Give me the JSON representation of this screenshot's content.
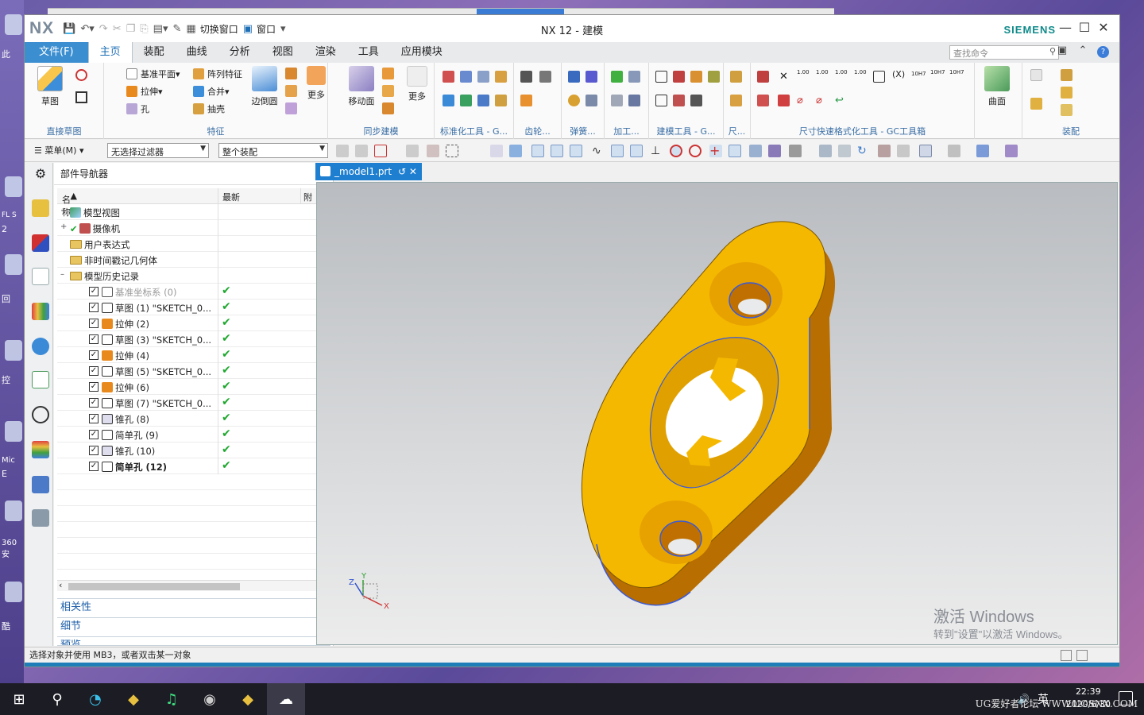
{
  "desktop": {
    "labels": [
      "此",
      "FL S",
      "2",
      "回",
      "控",
      "Mic",
      "E",
      "360安",
      "酷"
    ]
  },
  "window": {
    "logo": "NX",
    "title": "NX 12 - 建模",
    "brand": "SIEMENS",
    "quick_access": {
      "switch_window": "切换窗口",
      "window": "窗口"
    }
  },
  "menu": {
    "file": "文件(F)",
    "tabs": [
      "主页",
      "装配",
      "曲线",
      "分析",
      "视图",
      "渲染",
      "工具",
      "应用模块"
    ],
    "search_placeholder": "查找命令"
  },
  "ribbon": {
    "sketch": "草图",
    "extrude": "拉伸",
    "hole": "孔",
    "datum_plane": "基准平面",
    "pattern_feature": "阵列特征",
    "unite": "合并",
    "shell": "抽壳",
    "edge_blend": "边倒圆",
    "more1": "更多",
    "move_face": "移动面",
    "more2": "更多",
    "surface": "曲面",
    "groups": [
      "直接草图",
      "特征",
      "同步建模",
      "标准化工具 - G...",
      "齿轮...",
      "弹簧...",
      "加工...",
      "建模工具 - G...",
      "尺...",
      "尺寸快速格式化工具 - GC工具箱",
      "装配"
    ]
  },
  "toolbar": {
    "menu": "菜单(M)",
    "filter": "无选择过滤器",
    "scope": "整个装配"
  },
  "navigator": {
    "title": "部件导航器",
    "col_name": "名称",
    "col_latest": "最新",
    "col_extra": "附",
    "top_items": [
      "模型视图",
      "摄像机",
      "用户表达式",
      "非时间戳记几何体",
      "模型历史记录"
    ],
    "history": [
      {
        "label": "基准坐标系 (0)",
        "type": "datum"
      },
      {
        "label": "草图 (1) \"SKETCH_0...",
        "type": "sketch"
      },
      {
        "label": "拉伸 (2)",
        "type": "extrude"
      },
      {
        "label": "草图 (3) \"SKETCH_0...",
        "type": "sketch"
      },
      {
        "label": "拉伸 (4)",
        "type": "extrude"
      },
      {
        "label": "草图 (5) \"SKETCH_0...",
        "type": "sketch"
      },
      {
        "label": "拉伸 (6)",
        "type": "extrude"
      },
      {
        "label": "草图 (7) \"SKETCH_0...",
        "type": "sketch"
      },
      {
        "label": "锥孔 (8)",
        "type": "csink"
      },
      {
        "label": "简单孔 (9)",
        "type": "hole"
      },
      {
        "label": "锥孔 (10)",
        "type": "csink"
      },
      {
        "label": "简单孔 (12)",
        "type": "hole"
      }
    ],
    "panels": [
      "相关性",
      "细节",
      "预览"
    ]
  },
  "graphics": {
    "tab": "_model1.prt",
    "axis_x": "X",
    "axis_y": "Y",
    "axis_z": "Z"
  },
  "activation": {
    "line1": "激活 Windows",
    "line2": "转到\"设置\"以激活 Windows。"
  },
  "status": "选择对象并使用 MB3，或者双击某一对象",
  "taskbar": {
    "time": "22:39",
    "date": "2020/6/30",
    "ime": "英"
  },
  "watermark": "UG爱好者论坛 WWW.UGSNX.COM",
  "colors": {
    "accent": "#1e7fd0",
    "part": "#f5b800",
    "check": "#1fa82f"
  }
}
